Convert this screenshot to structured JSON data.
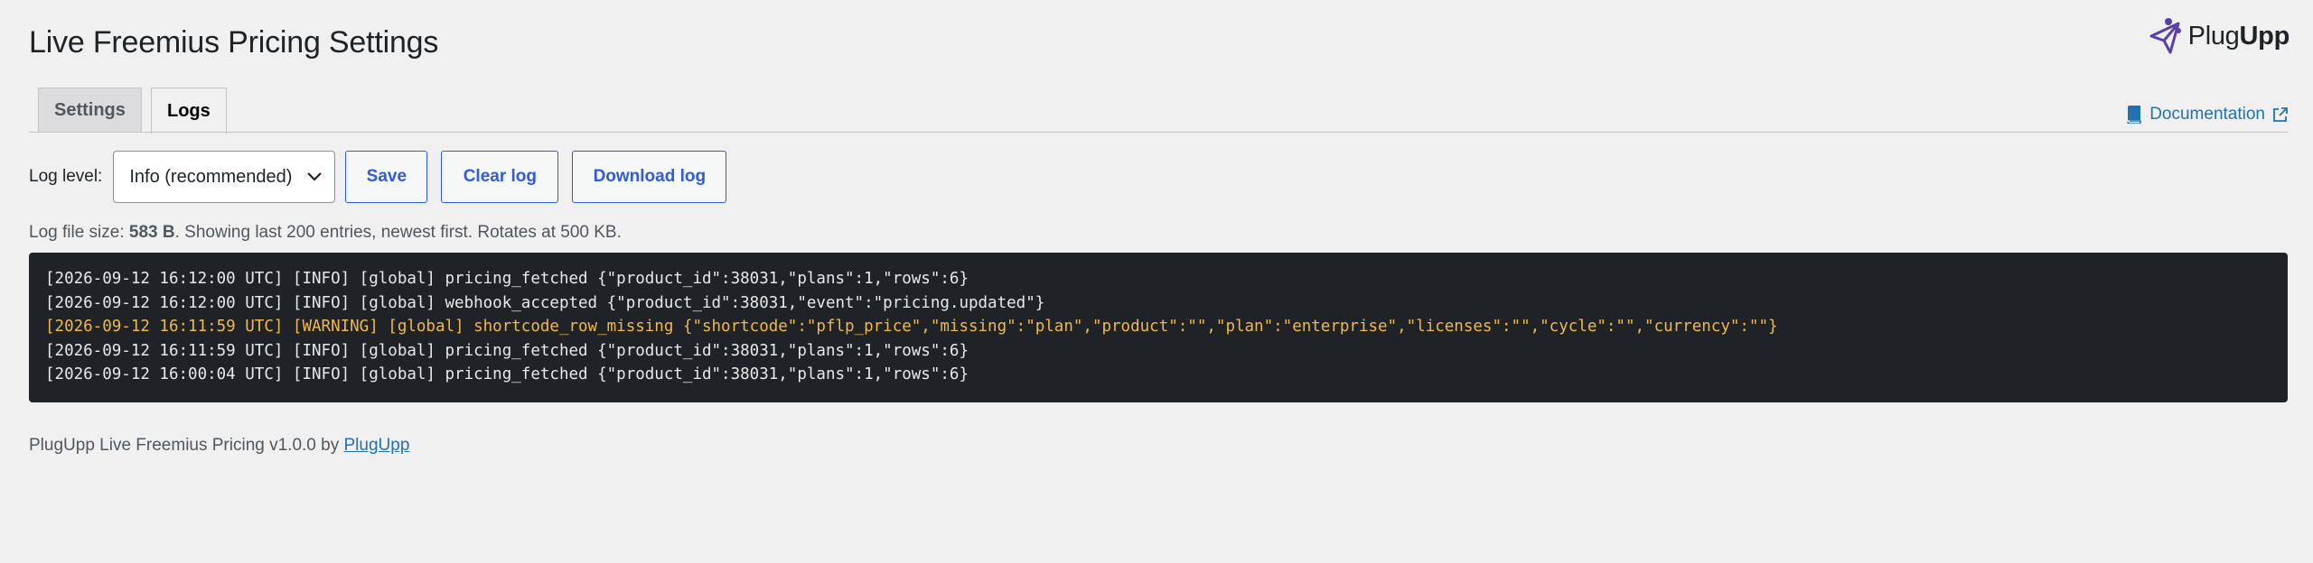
{
  "page": {
    "title": "Live Freemius Pricing Settings"
  },
  "brand": {
    "name_regular": "Plug",
    "name_bold": "Upp",
    "icon": "paper-plane-logo"
  },
  "tabs": [
    {
      "label": "Settings",
      "active": false
    },
    {
      "label": "Logs",
      "active": true
    }
  ],
  "docs": {
    "label": "Documentation",
    "icon": "book-icon",
    "external_icon": "external-link-icon"
  },
  "controls": {
    "log_level_label": "Log level:",
    "log_level_value": "Info (recommended)",
    "save_label": "Save",
    "clear_label": "Clear log",
    "download_label": "Download log"
  },
  "file_info": {
    "prefix": "Log file size: ",
    "size": "583 B",
    "suffix": ". Showing last 200 entries, newest first. Rotates at 500 KB."
  },
  "log": {
    "entries": [
      {
        "level": "info",
        "text": "[2026-09-12 16:12:00 UTC] [INFO] [global] pricing_fetched {\"product_id\":38031,\"plans\":1,\"rows\":6}"
      },
      {
        "level": "info",
        "text": "[2026-09-12 16:12:00 UTC] [INFO] [global] webhook_accepted {\"product_id\":38031,\"event\":\"pricing.updated\"}"
      },
      {
        "level": "warning",
        "text": "[2026-09-12 16:11:59 UTC] [WARNING] [global] shortcode_row_missing {\"shortcode\":\"pflp_price\",\"missing\":\"plan\",\"product\":\"\",\"plan\":\"enterprise\",\"licenses\":\"\",\"cycle\":\"\",\"currency\":\"\"}"
      },
      {
        "level": "info",
        "text": "[2026-09-12 16:11:59 UTC] [INFO] [global] pricing_fetched {\"product_id\":38031,\"plans\":1,\"rows\":6}"
      },
      {
        "level": "info",
        "text": "[2026-09-12 16:00:04 UTC] [INFO] [global] pricing_fetched {\"product_id\":38031,\"plans\":1,\"rows\":6}"
      }
    ]
  },
  "footer": {
    "text": "PlugUpp Live Freemius Pricing v1.0.0 by ",
    "link": "PlugUpp"
  },
  "colors": {
    "background": "#f0f0f1",
    "accent": "#2f5bdc",
    "link": "#2271b1",
    "log_background": "#1f2327",
    "warning": "#f0b849"
  }
}
